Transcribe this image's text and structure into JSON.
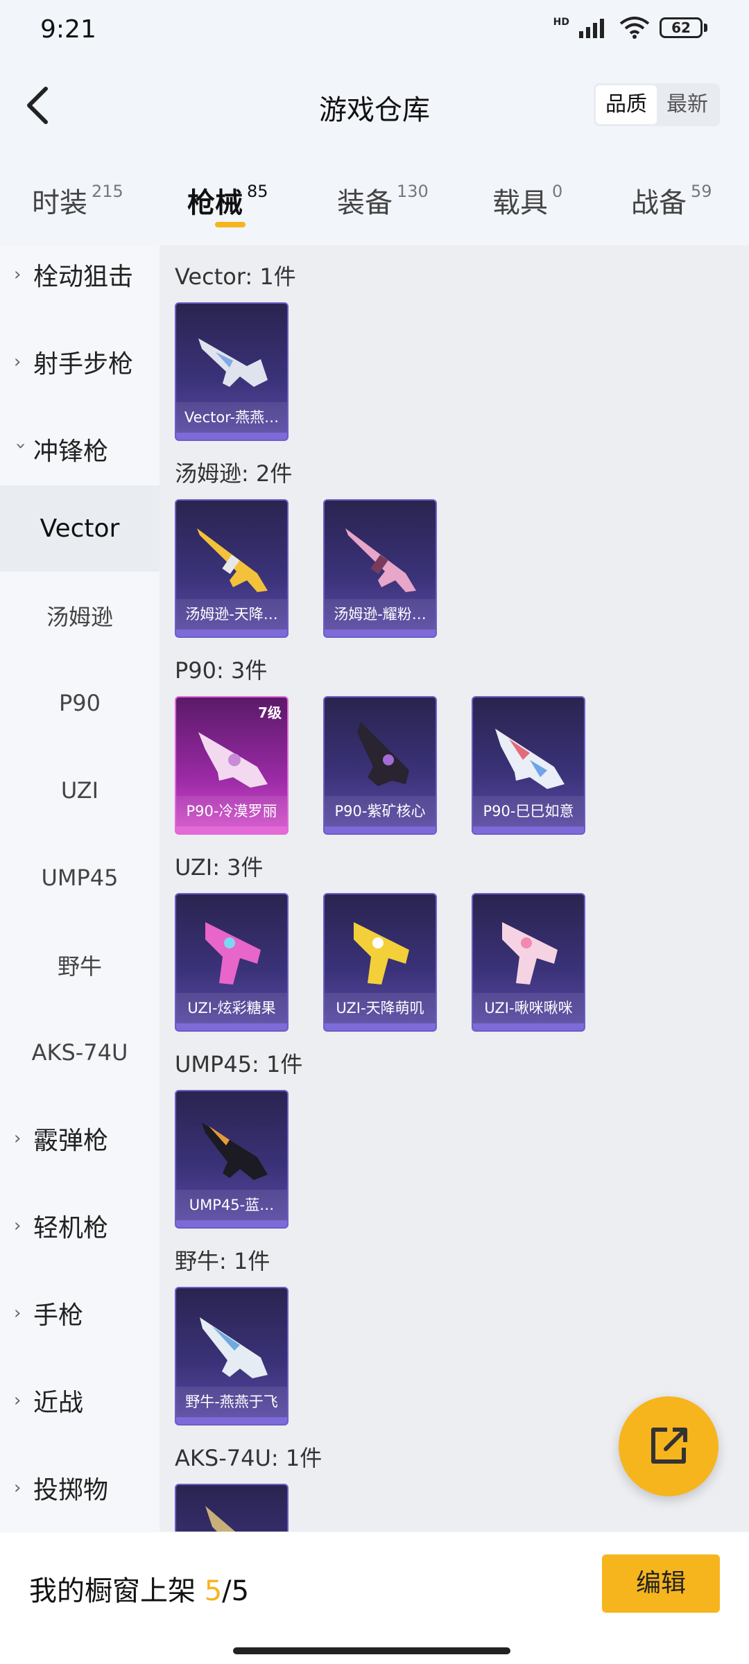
{
  "status": {
    "time": "9:21",
    "hd": "HD",
    "battery": "62"
  },
  "header": {
    "title": "游戏仓库",
    "sort_options": [
      "品质",
      "最新"
    ]
  },
  "tabs": [
    {
      "label": "时装",
      "count": "215"
    },
    {
      "label": "枪械",
      "count": "85"
    },
    {
      "label": "装备",
      "count": "130"
    },
    {
      "label": "载具",
      "count": "0"
    },
    {
      "label": "战备",
      "count": "59"
    }
  ],
  "sidebar": {
    "cat_bolt": "栓动狙击",
    "cat_marksman": "射手步枪",
    "cat_smg": "冲锋枪",
    "subs": [
      "Vector",
      "汤姆逊",
      "P90",
      "UZI",
      "UMP45",
      "野牛",
      "AKS-74U"
    ],
    "cat_shotgun": "霰弹枪",
    "cat_lmg": "轻机枪",
    "cat_pistol": "手枪",
    "cat_melee": "近战",
    "cat_throw": "投掷物"
  },
  "groups": {
    "vector": {
      "title": "Vector: 1件",
      "items": [
        "Vector-燕燕…"
      ]
    },
    "thompson": {
      "title": "汤姆逊: 2件",
      "items": [
        "汤姆逊-天降…",
        "汤姆逊-耀粉…"
      ]
    },
    "p90": {
      "title": "P90: 3件",
      "items": [
        "P90-冷漠罗丽",
        "P90-紫矿核心",
        "P90-巳巳如意"
      ],
      "level": "7级"
    },
    "uzi": {
      "title": "UZI: 3件",
      "items": [
        "UZI-炫彩糖果",
        "UZI-天降萌叽",
        "UZI-啾咪啾咪"
      ]
    },
    "ump45": {
      "title": "UMP45: 1件",
      "items": [
        "UMP45-蓝…"
      ]
    },
    "bison": {
      "title": "野牛: 1件",
      "items": [
        "野牛-燕燕于飞"
      ]
    },
    "aks": {
      "title": "AKS-74U: 1件"
    }
  },
  "footer": {
    "label": "我的橱窗上架 ",
    "count": "5",
    "total": "/5",
    "edit": "编辑"
  },
  "colors": {
    "accent": "#f6b51d"
  }
}
